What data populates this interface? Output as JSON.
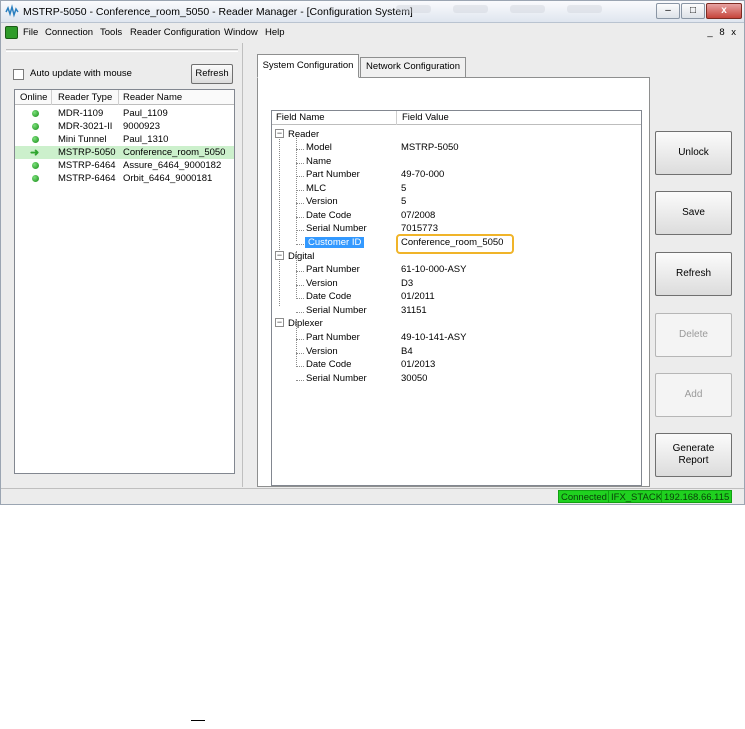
{
  "window": {
    "title": "MSTRP-5050 - Conference_room_5050 - Reader Manager - [Configuration System]",
    "minimize": "–",
    "maximize": "□",
    "close": "x"
  },
  "menu": {
    "items": [
      "File",
      "Connection",
      "Tools",
      "Reader Configuration",
      "Window",
      "Help"
    ],
    "mdi_controls": "_ 8 x"
  },
  "left": {
    "auto_update_label": "Auto update with mouse",
    "auto_update_checked": false,
    "refresh_label": "Refresh",
    "columns": [
      "Online",
      "Reader Type",
      "Reader Name"
    ],
    "readers": [
      {
        "status": "online",
        "type": "MDR-1109",
        "name": "Paul_1109"
      },
      {
        "status": "online",
        "type": "MDR-3021-II",
        "name": "9000923"
      },
      {
        "status": "online",
        "type": "Mini Tunnel",
        "name": "Paul_1310"
      },
      {
        "status": "current",
        "type": "MSTRP-5050",
        "name": "Conference_room_5050"
      },
      {
        "status": "online",
        "type": "MSTRP-6464",
        "name": "Assure_6464_9000182"
      },
      {
        "status": "online",
        "type": "MSTRP-6464",
        "name": "Orbit_6464_9000181"
      }
    ]
  },
  "tabs": [
    "System Configuration",
    "Network Configuration"
  ],
  "tree": {
    "col_field": "Field Name",
    "col_value": "Field Value",
    "groups": [
      {
        "name": "Reader",
        "fields": [
          {
            "name": "Model",
            "value": "MSTRP-5050"
          },
          {
            "name": "Name",
            "value": ""
          },
          {
            "name": "Part Number",
            "value": "49-70-000"
          },
          {
            "name": "MLC",
            "value": "5"
          },
          {
            "name": "Version",
            "value": "5"
          },
          {
            "name": "Date Code",
            "value": "07/2008"
          },
          {
            "name": "Serial Number",
            "value": "7015773"
          },
          {
            "name": "Customer ID",
            "value": "Conference_room_5050"
          }
        ]
      },
      {
        "name": "Digital",
        "fields": [
          {
            "name": "Part Number",
            "value": "61-10-000-ASY"
          },
          {
            "name": "Version",
            "value": "D3"
          },
          {
            "name": "Date Code",
            "value": "01/2011"
          },
          {
            "name": "Serial Number",
            "value": "31151"
          }
        ]
      },
      {
        "name": "Diplexer",
        "fields": [
          {
            "name": "Part Number",
            "value": "49-10-141-ASY"
          },
          {
            "name": "Version",
            "value": "B4"
          },
          {
            "name": "Date Code",
            "value": "01/2013"
          },
          {
            "name": "Serial Number",
            "value": "30050"
          }
        ]
      }
    ]
  },
  "buttons": {
    "unlock": "Unlock",
    "save": "Save",
    "refresh": "Refresh",
    "delete": "Delete",
    "add": "Add",
    "generate_line1": "Generate",
    "generate_line2": "Report"
  },
  "status": {
    "connection": "Connected",
    "stack": "IFX_STACK",
    "ip": "192.168.66.115"
  },
  "colors": {
    "selected_row": "#ccf0cc",
    "status_green": "#1fd11f",
    "highlight_orange": "#f0b429",
    "selection_blue": "#3399ff"
  }
}
